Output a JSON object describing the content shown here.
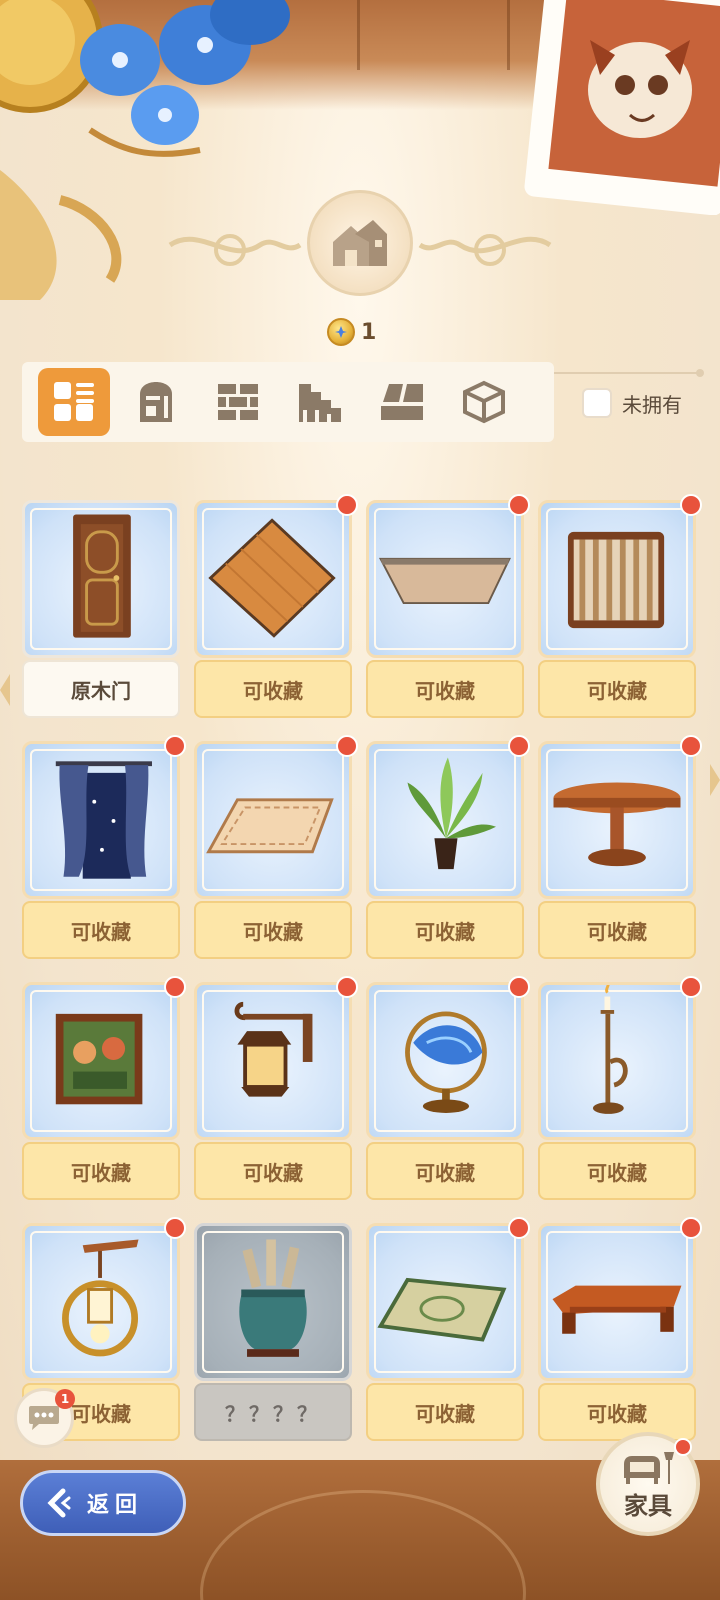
{
  "header": {
    "emblem_icon": "house-icon",
    "currency_icon": "gold-coin-icon",
    "currency_value": "1"
  },
  "filter": {
    "tabs": [
      {
        "icon": "grid-icon",
        "active": true
      },
      {
        "icon": "door-icon",
        "active": false
      },
      {
        "icon": "wall-icon",
        "active": false
      },
      {
        "icon": "stairs-icon",
        "active": false
      },
      {
        "icon": "floor-icon",
        "active": false
      },
      {
        "icon": "box-icon",
        "active": false
      }
    ],
    "not_owned_label": "未拥有"
  },
  "items": [
    {
      "name": "wooden-door",
      "label": "原木门",
      "state": "owned",
      "new": false
    },
    {
      "name": "wood-floor",
      "label": "可收藏",
      "state": "collectible",
      "new": true
    },
    {
      "name": "ceiling-panel",
      "label": "可收藏",
      "state": "collectible",
      "new": true
    },
    {
      "name": "striped-wallpaper",
      "label": "可收藏",
      "state": "collectible",
      "new": true
    },
    {
      "name": "curtain-window",
      "label": "可收藏",
      "state": "collectible",
      "new": true
    },
    {
      "name": "carpet",
      "label": "可收藏",
      "state": "collectible",
      "new": true
    },
    {
      "name": "potted-plant",
      "label": "可收藏",
      "state": "collectible",
      "new": true
    },
    {
      "name": "round-table",
      "label": "可收藏",
      "state": "collectible",
      "new": true
    },
    {
      "name": "framed-painting",
      "label": "可收藏",
      "state": "collectible",
      "new": true
    },
    {
      "name": "wall-lantern",
      "label": "可收藏",
      "state": "collectible",
      "new": true
    },
    {
      "name": "globe-ornament",
      "label": "可收藏",
      "state": "collectible",
      "new": true
    },
    {
      "name": "candle-stand",
      "label": "可收藏",
      "state": "collectible",
      "new": true
    },
    {
      "name": "hanging-lamp",
      "label": "可收藏",
      "state": "collectible",
      "new": true
    },
    {
      "name": "scroll-vase",
      "label": "？？？？",
      "state": "locked",
      "new": false
    },
    {
      "name": "green-rug",
      "label": "可收藏",
      "state": "collectible",
      "new": true
    },
    {
      "name": "low-table",
      "label": "可收藏",
      "state": "collectible",
      "new": true
    }
  ],
  "chat": {
    "icon": "chat-bubble-icon",
    "badge": "1"
  },
  "back_button": {
    "icon": "back-arrow-icon",
    "label": "返回"
  },
  "furniture_button": {
    "icon": "sofa-lamp-icon",
    "label": "家具"
  },
  "colors": {
    "accent_orange": "#ee9a3b",
    "badge_red": "#e8533c",
    "collect_label_bg": "#fde6a8",
    "back_blue": "#4a6cc6"
  }
}
